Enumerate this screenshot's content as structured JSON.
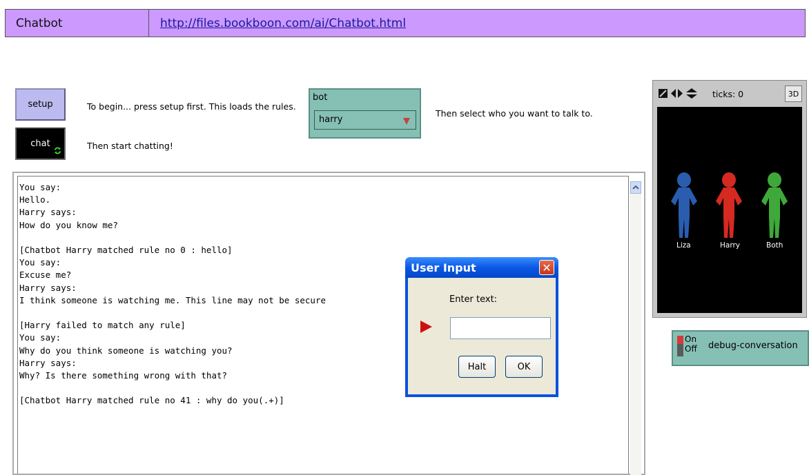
{
  "header": {
    "title": "Chatbot",
    "url": "http://files.bookboon.com/ai/Chatbot.html"
  },
  "buttons": {
    "setup": "setup",
    "chat": "chat"
  },
  "labels": {
    "begin": "To begin... press setup first. This loads the rules.",
    "start_chatting": "Then start chatting!",
    "select_who": "Then select who you want to talk to."
  },
  "chooser": {
    "title": "bot",
    "value": "harry"
  },
  "output": {
    "text": "You say:\nHello.\nHarry says:\nHow do you know me?\n\n[Chatbot Harry matched rule no 0 : hello]\nYou say:\nExcuse me?\nHarry says:\nI think someone is watching me. This line may not be secure\n\n[Harry failed to match any rule]\nYou say:\nWhy do you think someone is watching you?\nHarry says:\nWhy? Is there something wrong with that?\n\n[Chatbot Harry matched rule no 41 : why do you(.+)]"
  },
  "dialog": {
    "title": "User Input",
    "prompt": "Enter text:",
    "input_value": "",
    "halt_label": "Halt",
    "ok_label": "OK"
  },
  "view": {
    "ticks": "ticks: 0",
    "btn_3d": "3D",
    "agents": [
      {
        "name": "Liza",
        "color": "#2a5db0"
      },
      {
        "name": "Harry",
        "color": "#d42a22"
      },
      {
        "name": "Both",
        "color": "#3fa83a"
      }
    ]
  },
  "switch": {
    "on_label": "On",
    "off_label": "Off",
    "name": "debug-conversation"
  },
  "colors": {
    "header_bg": "#cc99ff",
    "widget_teal": "#86c0b4",
    "button_blue": "#bbbbf0"
  }
}
